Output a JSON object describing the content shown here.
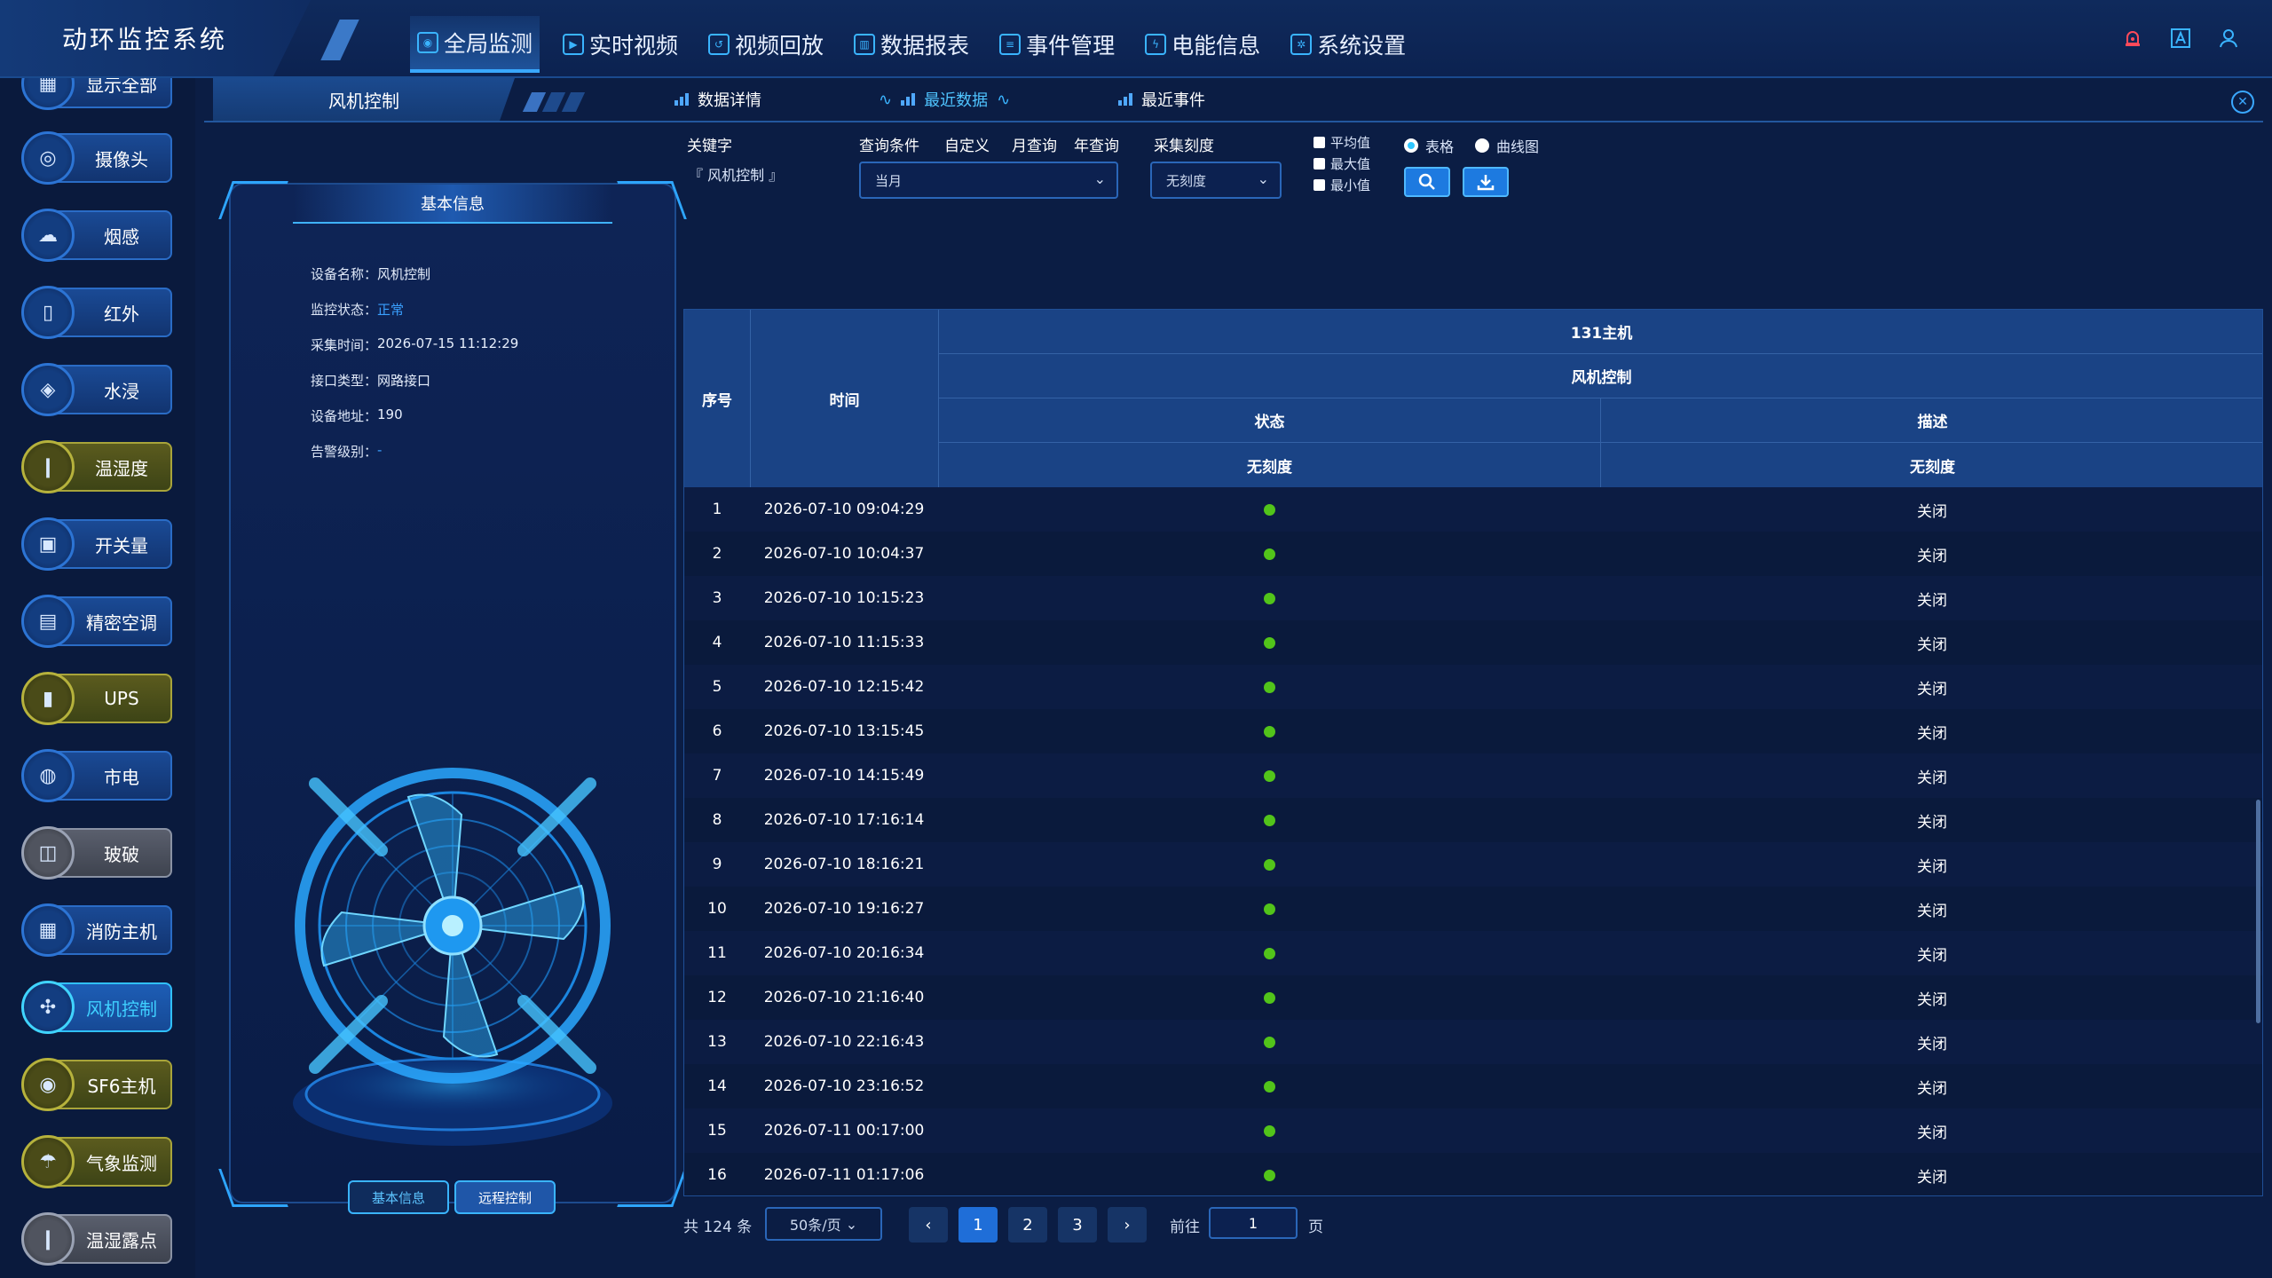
{
  "app": {
    "title": "动环监控系统"
  },
  "nav": [
    {
      "label": "全局监测",
      "icon": "monitor-icon",
      "active": true
    },
    {
      "label": "实时视频",
      "icon": "video-play-icon"
    },
    {
      "label": "视频回放",
      "icon": "replay-icon"
    },
    {
      "label": "数据报表",
      "icon": "chart-icon"
    },
    {
      "label": "事件管理",
      "icon": "list-icon"
    },
    {
      "label": "电能信息",
      "icon": "lightning-icon"
    },
    {
      "label": "系统设置",
      "icon": "gear-icon"
    }
  ],
  "top_icons": [
    "alarm-icon",
    "font-a-icon",
    "user-icon"
  ],
  "sidebar": {
    "items": [
      {
        "label": "显示全部",
        "style": "blue"
      },
      {
        "label": "摄像头",
        "style": "blue"
      },
      {
        "label": "烟感",
        "style": "blue"
      },
      {
        "label": "红外",
        "style": "blue"
      },
      {
        "label": "水浸",
        "style": "blue"
      },
      {
        "label": "温湿度",
        "style": "yellow"
      },
      {
        "label": "开关量",
        "style": "blue"
      },
      {
        "label": "精密空调",
        "style": "blue"
      },
      {
        "label": "UPS",
        "style": "yellow"
      },
      {
        "label": "市电",
        "style": "blue"
      },
      {
        "label": "玻破",
        "style": "gray"
      },
      {
        "label": "消防主机",
        "style": "blue"
      },
      {
        "label": "风机控制",
        "style": "active"
      },
      {
        "label": "SF6主机",
        "style": "yellow"
      },
      {
        "label": "气象监测",
        "style": "yellow"
      },
      {
        "label": "温湿露点",
        "style": "gray"
      }
    ]
  },
  "tabs": {
    "main": "风机控制",
    "sub": [
      {
        "label": "数据详情",
        "active": false
      },
      {
        "label": "最近数据",
        "active": true
      },
      {
        "label": "最近事件",
        "active": false
      }
    ]
  },
  "card": {
    "header": "基本信息",
    "fields": [
      {
        "label": "设备名称：",
        "value": "风机控制"
      },
      {
        "label": "监控状态：",
        "value": "正常"
      },
      {
        "label": "采集时间：",
        "value": "2026-07-15 11:12:29"
      },
      {
        "label": "接口类型：",
        "value": "网路接口"
      },
      {
        "label": "设备地址：",
        "value": "190"
      },
      {
        "label": "告警级别：",
        "value": "-"
      }
    ],
    "btn_basic": "基本信息",
    "btn_remote": "远程控制"
  },
  "query": {
    "keyword_label": "关键字",
    "keyword_value": "『 风机控制 』",
    "condition_label": "查询条件",
    "custom": "自定义",
    "month": "月查询",
    "year": "年查询",
    "condition_value": "当月",
    "scale_label": "采集刻度",
    "scale_value": "无刻度",
    "avg": "平均值",
    "max": "最大值",
    "min": "最小值",
    "table_opt": "表格",
    "curve_opt": "曲线图"
  },
  "table": {
    "headers": {
      "index": "序号",
      "time": "时间",
      "host": "131主机",
      "device": "风机控制",
      "status": "状态",
      "desc": "描述",
      "scale_a": "无刻度",
      "scale_b": "无刻度"
    },
    "rows": [
      {
        "no": "1",
        "time": "2026-07-10 09:04:29",
        "desc": "关闭"
      },
      {
        "no": "2",
        "time": "2026-07-10 10:04:37",
        "desc": "关闭"
      },
      {
        "no": "3",
        "time": "2026-07-10 10:15:23",
        "desc": "关闭"
      },
      {
        "no": "4",
        "time": "2026-07-10 11:15:33",
        "desc": "关闭"
      },
      {
        "no": "5",
        "time": "2026-07-10 12:15:42",
        "desc": "关闭"
      },
      {
        "no": "6",
        "time": "2026-07-10 13:15:45",
        "desc": "关闭"
      },
      {
        "no": "7",
        "time": "2026-07-10 14:15:49",
        "desc": "关闭"
      },
      {
        "no": "8",
        "time": "2026-07-10 17:16:14",
        "desc": "关闭"
      },
      {
        "no": "9",
        "time": "2026-07-10 18:16:21",
        "desc": "关闭"
      },
      {
        "no": "10",
        "time": "2026-07-10 19:16:27",
        "desc": "关闭"
      },
      {
        "no": "11",
        "time": "2026-07-10 20:16:34",
        "desc": "关闭"
      },
      {
        "no": "12",
        "time": "2026-07-10 21:16:40",
        "desc": "关闭"
      },
      {
        "no": "13",
        "time": "2026-07-10 22:16:43",
        "desc": "关闭"
      },
      {
        "no": "14",
        "time": "2026-07-10 23:16:52",
        "desc": "关闭"
      },
      {
        "no": "15",
        "time": "2026-07-11 00:17:00",
        "desc": "关闭"
      },
      {
        "no": "16",
        "time": "2026-07-11 01:17:06",
        "desc": "关闭"
      }
    ]
  },
  "pager": {
    "total": "共 124 条",
    "size": "50条/页",
    "pages": [
      "1",
      "2",
      "3"
    ],
    "current": "1",
    "goto": "前往",
    "goto_value": "1",
    "unit": "页"
  },
  "colors": {
    "background": "#0b1d44",
    "accent": "#39a8ff",
    "status_green": "#52c41a"
  }
}
